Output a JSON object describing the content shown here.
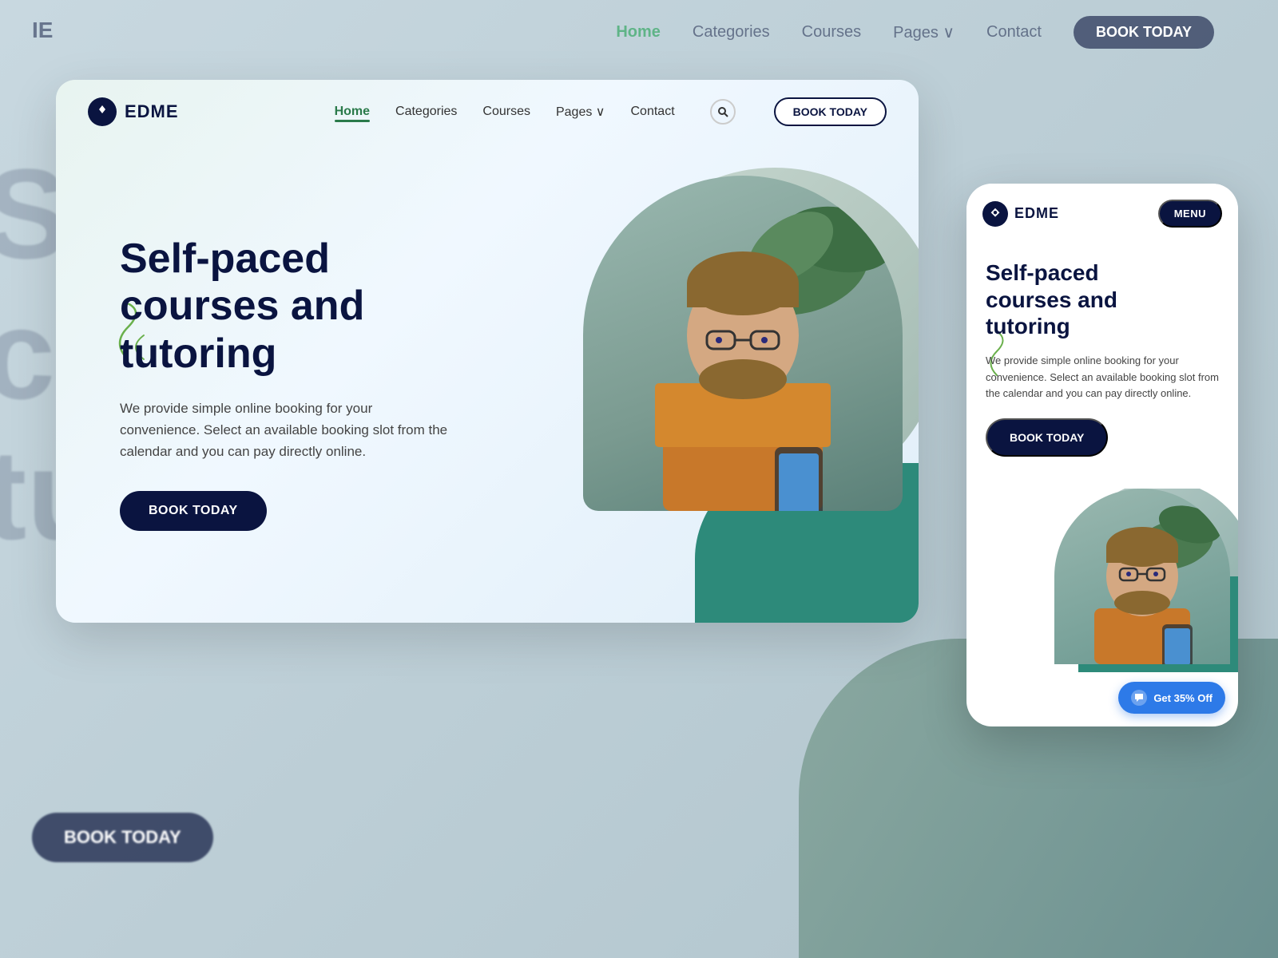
{
  "background": {
    "logo": "IE",
    "nav_items": [
      "Home",
      "Categories",
      "Courses",
      "Pages ∨",
      "Contact"
    ],
    "book_btn": "BOOK TODAY",
    "bottom_btn": "BOOK TODAY",
    "big_text_lines": [
      "S",
      "c",
      "tu"
    ]
  },
  "desktop": {
    "logo_text": "EDME",
    "nav": {
      "home": "Home",
      "categories": "Categories",
      "courses": "Courses",
      "pages": "Pages",
      "contact": "Contact",
      "book_btn": "BOOK TODAY"
    },
    "hero": {
      "title_line1": "Self-paced",
      "title_line2": "courses and",
      "title_line3": "tutoring",
      "description": "We provide simple online booking for your convenience. Select an available booking slot from the calendar and you can pay directly online.",
      "book_btn": "BOOK TODAY"
    }
  },
  "mobile": {
    "logo_text": "EDME",
    "menu_btn": "MENU",
    "hero": {
      "title_line1": "Self-paced",
      "title_line2": "courses and",
      "title_line3": "tutoring",
      "description": "We provide simple online booking for your convenience. Select an available booking slot from the calendar and you can pay directly online.",
      "book_btn": "BOOK TODAY"
    },
    "chat_bubble": "Get 35% Off"
  },
  "icons": {
    "logo_diamond": "◆",
    "search": "○",
    "chat": "💬"
  },
  "colors": {
    "dark_navy": "#0a1440",
    "green_accent": "#2a7a4a",
    "teal": "#2d8a7a",
    "blue_chat": "#2d7ae8"
  }
}
